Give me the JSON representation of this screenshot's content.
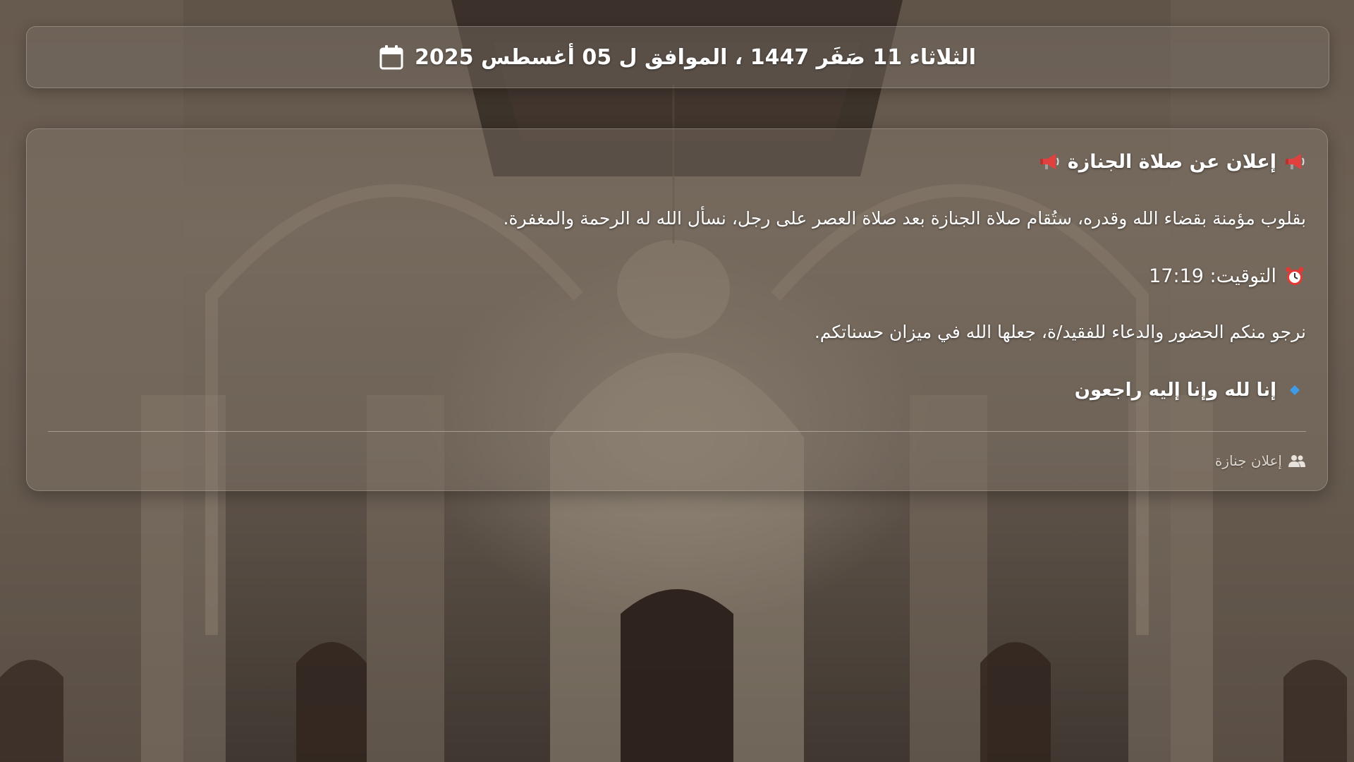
{
  "header": {
    "date_text": "الثلاثاء 11 صَفَر 1447 ، الموافق ل 05 أغسطس 2025",
    "icon": "calendar-icon"
  },
  "announcement": {
    "title": "إعلان عن صلاة الجنازة",
    "title_icon": "megaphone-icon",
    "body": "بقلوب مؤمنة بقضاء الله وقدره، ستُقام صلاة الجنازة بعد صلاة العصر على رجل، نسأل الله له الرحمة والمغفرة.",
    "time_label": "التوقيت: 17:19",
    "time_icon": "alarm-clock-icon",
    "invite": "نرجو منكم الحضور والدعاء للفقيد/ة، جعلها الله في ميزان حسناتكم.",
    "verse": "إنا لله وإنا إليه راجعون",
    "verse_icon": "blue-diamond-icon",
    "footer_label": "إعلان جنازة",
    "footer_icon": "people-icon"
  },
  "colors": {
    "text": "#ffffff",
    "diamond": "#3d9be9",
    "megaphone": "#e0413f",
    "alarm": "#e53935"
  }
}
